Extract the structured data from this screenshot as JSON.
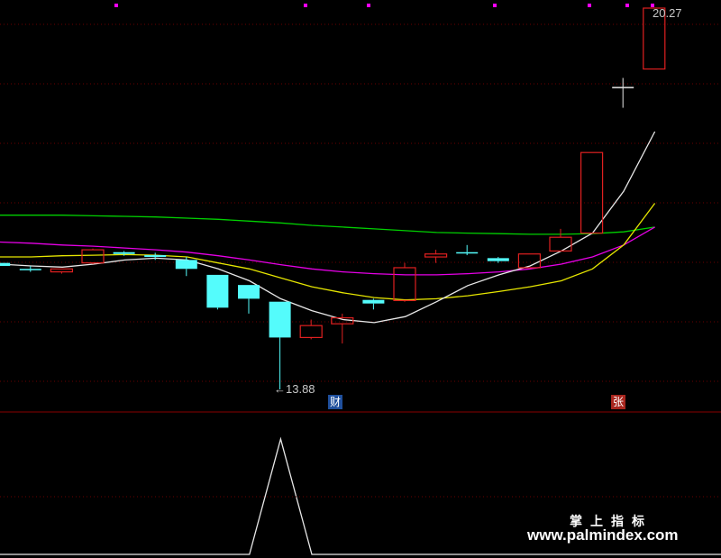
{
  "stock_chart": {
    "high_label": "20.27",
    "low_label": "13.88",
    "signal_badges": [
      {
        "text": "财",
        "color": "#1f4f9c"
      },
      {
        "text": "张",
        "color": "#a8261e"
      }
    ],
    "colors": {
      "background": "#000000",
      "up_candle": "#e02020",
      "down_candle": "#54fcfc",
      "ma_short": "#e8e8e8",
      "ma_mid": "#e6e600",
      "ma_long": "#e600e6",
      "ma_longest": "#00d000",
      "marker": "#ff00ff",
      "grid": "#6a0000",
      "indicator_line": "#e8e8e8"
    },
    "candles": [
      {
        "o": 16.0,
        "c": 15.95,
        "h": 16.05,
        "l": 15.9,
        "trend": "down"
      },
      {
        "o": 15.9,
        "c": 15.9,
        "h": 15.95,
        "l": 15.85,
        "trend": "flat"
      },
      {
        "o": 15.85,
        "c": 15.9,
        "h": 15.9,
        "l": 15.82,
        "trend": "up"
      },
      {
        "o": 16.0,
        "c": 16.22,
        "h": 16.24,
        "l": 15.98,
        "trend": "up"
      },
      {
        "o": 16.18,
        "c": 16.15,
        "h": 16.2,
        "l": 16.12,
        "trend": "down"
      },
      {
        "o": 16.13,
        "c": 16.1,
        "h": 16.17,
        "l": 16.05,
        "trend": "down"
      },
      {
        "o": 16.05,
        "c": 15.9,
        "h": 16.1,
        "l": 15.78,
        "trend": "down"
      },
      {
        "o": 15.8,
        "c": 15.25,
        "h": 15.8,
        "l": 15.22,
        "trend": "down"
      },
      {
        "o": 15.63,
        "c": 15.4,
        "h": 15.63,
        "l": 15.15,
        "trend": "down"
      },
      {
        "o": 15.35,
        "c": 14.75,
        "h": 15.35,
        "l": 13.88,
        "trend": "down"
      },
      {
        "o": 14.75,
        "c": 14.95,
        "h": 15.05,
        "l": 14.72,
        "trend": "up"
      },
      {
        "o": 14.98,
        "c": 15.08,
        "h": 15.15,
        "l": 14.65,
        "trend": "up"
      },
      {
        "o": 15.38,
        "c": 15.32,
        "h": 15.4,
        "l": 15.22,
        "trend": "down"
      },
      {
        "o": 15.37,
        "c": 15.92,
        "h": 16.0,
        "l": 15.35,
        "trend": "up"
      },
      {
        "o": 16.1,
        "c": 16.15,
        "h": 16.22,
        "l": 16.0,
        "trend": "up"
      },
      {
        "o": 16.18,
        "c": 16.17,
        "h": 16.3,
        "l": 16.13,
        "trend": "flat"
      },
      {
        "o": 16.08,
        "c": 16.03,
        "h": 16.1,
        "l": 16.0,
        "trend": "down"
      },
      {
        "o": 15.92,
        "c": 16.15,
        "h": 16.15,
        "l": 15.92,
        "trend": "up"
      },
      {
        "o": 16.2,
        "c": 16.43,
        "h": 16.57,
        "l": 16.2,
        "trend": "up"
      },
      {
        "o": 16.5,
        "c": 17.85,
        "h": 17.85,
        "l": 16.5,
        "trend": "up"
      },
      {
        "o": 18.95,
        "c": 18.95,
        "h": 19.1,
        "l": 18.6,
        "trend": "flat"
      },
      {
        "o": 19.25,
        "c": 20.27,
        "h": 20.27,
        "l": 19.25,
        "trend": "up"
      }
    ],
    "ma_short": [
      15.98,
      15.95,
      15.93,
      15.98,
      16.05,
      16.08,
      16.05,
      15.9,
      15.7,
      15.4,
      15.2,
      15.05,
      15.0,
      15.1,
      15.35,
      15.62,
      15.8,
      15.95,
      16.2,
      16.5,
      17.2,
      18.2
    ],
    "ma_mid": [
      16.1,
      16.1,
      16.12,
      16.13,
      16.14,
      16.13,
      16.1,
      16.0,
      15.9,
      15.75,
      15.6,
      15.5,
      15.42,
      15.38,
      15.4,
      15.45,
      15.52,
      15.6,
      15.7,
      15.9,
      16.3,
      17.0
    ],
    "ma_long": [
      16.35,
      16.33,
      16.3,
      16.28,
      16.25,
      16.22,
      16.18,
      16.12,
      16.05,
      15.97,
      15.9,
      15.85,
      15.82,
      15.8,
      15.8,
      15.82,
      15.85,
      15.9,
      15.98,
      16.1,
      16.3,
      16.6
    ],
    "ma_longest": [
      16.8,
      16.8,
      16.8,
      16.79,
      16.78,
      16.77,
      16.75,
      16.73,
      16.7,
      16.67,
      16.63,
      16.6,
      16.57,
      16.54,
      16.51,
      16.5,
      16.49,
      16.48,
      16.48,
      16.49,
      16.52,
      16.6
    ],
    "indicator_values": [
      0,
      0,
      0,
      0,
      0,
      0,
      0,
      0,
      0,
      1,
      0,
      0,
      0,
      0,
      0,
      0,
      0,
      0,
      0,
      0,
      0,
      0
    ]
  },
  "watermark": {
    "cn": "掌上指标",
    "url": "www.palmindex.com"
  }
}
